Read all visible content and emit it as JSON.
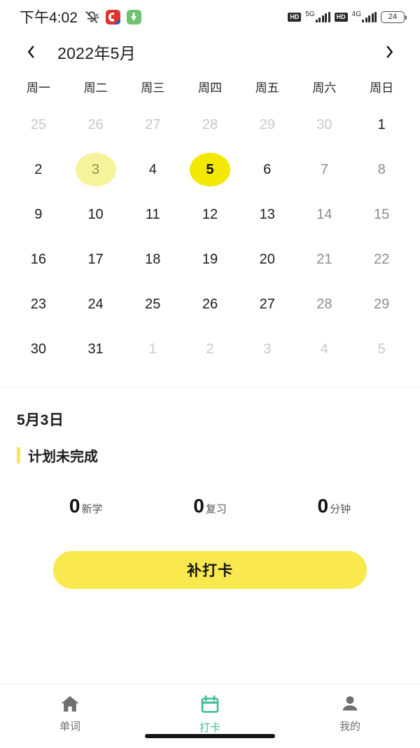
{
  "status_bar": {
    "time": "下午4:02",
    "icons_left": [
      "bell-off-icon",
      "app-badge-c-icon",
      "download-badge-icon"
    ],
    "network": [
      {
        "hd_label": "HD",
        "gen_label": "5G",
        "bars": 5
      },
      {
        "hd_label": "HD",
        "gen_label": "4G",
        "bars": 5
      }
    ],
    "battery_percent": "24"
  },
  "calendar": {
    "title": "2022年5月",
    "prev_icon": "chevron-left-icon",
    "next_icon": "chevron-right-icon",
    "weekdays": [
      "周一",
      "周二",
      "周三",
      "周四",
      "周五",
      "周六",
      "周日"
    ],
    "weeks": [
      [
        {
          "day": "25",
          "state": "muted"
        },
        {
          "day": "26",
          "state": "muted"
        },
        {
          "day": "27",
          "state": "muted"
        },
        {
          "day": "28",
          "state": "muted"
        },
        {
          "day": "29",
          "state": "muted"
        },
        {
          "day": "30",
          "state": "muted"
        },
        {
          "day": "1",
          "state": "normal"
        }
      ],
      [
        {
          "day": "2",
          "state": "normal"
        },
        {
          "day": "3",
          "state": "selected"
        },
        {
          "day": "4",
          "state": "normal"
        },
        {
          "day": "5",
          "state": "today"
        },
        {
          "day": "6",
          "state": "normal"
        },
        {
          "day": "7",
          "state": "weekend"
        },
        {
          "day": "8",
          "state": "weekend"
        }
      ],
      [
        {
          "day": "9",
          "state": "normal"
        },
        {
          "day": "10",
          "state": "normal"
        },
        {
          "day": "11",
          "state": "normal"
        },
        {
          "day": "12",
          "state": "normal"
        },
        {
          "day": "13",
          "state": "normal"
        },
        {
          "day": "14",
          "state": "weekend"
        },
        {
          "day": "15",
          "state": "weekend"
        }
      ],
      [
        {
          "day": "16",
          "state": "normal"
        },
        {
          "day": "17",
          "state": "normal"
        },
        {
          "day": "18",
          "state": "normal"
        },
        {
          "day": "19",
          "state": "normal"
        },
        {
          "day": "20",
          "state": "normal"
        },
        {
          "day": "21",
          "state": "weekend"
        },
        {
          "day": "22",
          "state": "weekend"
        }
      ],
      [
        {
          "day": "23",
          "state": "normal"
        },
        {
          "day": "24",
          "state": "normal"
        },
        {
          "day": "25",
          "state": "normal"
        },
        {
          "day": "26",
          "state": "normal"
        },
        {
          "day": "27",
          "state": "normal"
        },
        {
          "day": "28",
          "state": "weekend"
        },
        {
          "day": "29",
          "state": "weekend"
        }
      ],
      [
        {
          "day": "30",
          "state": "normal"
        },
        {
          "day": "31",
          "state": "normal"
        },
        {
          "day": "1",
          "state": "muted"
        },
        {
          "day": "2",
          "state": "muted"
        },
        {
          "day": "3",
          "state": "muted"
        },
        {
          "day": "4",
          "state": "muted"
        },
        {
          "day": "5",
          "state": "muted"
        }
      ]
    ]
  },
  "detail": {
    "date": "5月3日",
    "status": "计划未完成",
    "stats": [
      {
        "value": "0",
        "label": "新学"
      },
      {
        "value": "0",
        "label": "复习"
      },
      {
        "value": "0",
        "label": "分钟"
      }
    ],
    "action_button": "补打卡"
  },
  "tabbar": {
    "items": [
      {
        "label": "单词",
        "icon": "home-icon",
        "active": false
      },
      {
        "label": "打卡",
        "icon": "calendar-icon",
        "active": true
      },
      {
        "label": "我的",
        "icon": "person-icon",
        "active": false
      }
    ]
  },
  "colors": {
    "today_yellow": "#F3E800",
    "selected_yellow": "#F6F49B",
    "button_yellow": "#F9E94E",
    "accent_bar_yellow": "#F5E65A",
    "active_tab_teal": "#3EBD93",
    "muted_gray": "#C9C9C9"
  }
}
